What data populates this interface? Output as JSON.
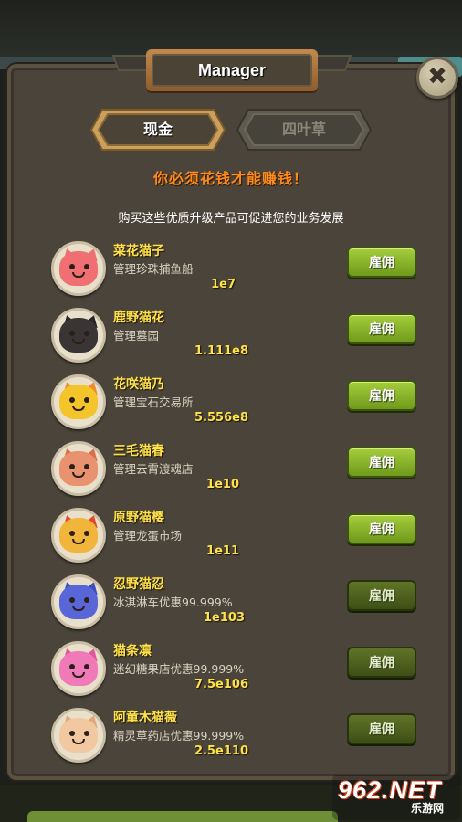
{
  "window": {
    "title": "Manager"
  },
  "tabs": [
    {
      "label": "现金",
      "active": true
    },
    {
      "label": "四叶草",
      "active": false
    }
  ],
  "headline": "你必须花钱才能赚钱！",
  "subline": "购买这些优质升级产品可促进您的业务发展",
  "managers": [
    {
      "name": "菜花猫子",
      "desc": "管理珍珠捕鱼船",
      "cost": "1e7",
      "hire_label": "雇佣",
      "hire_enabled": true,
      "face_color": "#ef6f72",
      "ear_color": "#ef6f72"
    },
    {
      "name": "鹿野猫花",
      "desc": "管理墓园",
      "cost": "1.111e8",
      "hire_label": "雇佣",
      "hire_enabled": true,
      "face_color": "#3a3535",
      "ear_color": "#2a2626"
    },
    {
      "name": "花咲猫乃",
      "desc": "管理宝石交易所",
      "cost": "5.556e8",
      "hire_label": "雇佣",
      "hire_enabled": true,
      "face_color": "#f4c52a",
      "ear_color": "#f08a2a"
    },
    {
      "name": "三毛猫春",
      "desc": "管理云霄渡魂店",
      "cost": "1e10",
      "hire_label": "雇佣",
      "hire_enabled": true,
      "face_color": "#e99270",
      "ear_color": "#d96f4c"
    },
    {
      "name": "原野猫樱",
      "desc": "管理龙蛋市场",
      "cost": "1e11",
      "hire_label": "雇佣",
      "hire_enabled": true,
      "face_color": "#f2b53c",
      "ear_color": "#e04a2c"
    },
    {
      "name": "忍野猫忍",
      "desc": "冰淇淋车优惠99.999%",
      "cost": "1e103",
      "hire_label": "雇佣",
      "hire_enabled": false,
      "face_color": "#5866d8",
      "ear_color": "#3f4cbb"
    },
    {
      "name": "猫条凛",
      "desc": "迷幻糖果店优惠99.999%",
      "cost": "7.5e106",
      "hire_label": "雇佣",
      "hire_enabled": false,
      "face_color": "#f07ab7",
      "ear_color": "#e0559c"
    },
    {
      "name": "阿童木猫薇",
      "desc": "精灵草药店优惠99.999%",
      "cost": "2.5e110",
      "hire_label": "雇佣",
      "hire_enabled": false,
      "face_color": "#f2c8a0",
      "ear_color": "#e0a77a"
    }
  ],
  "watermark": {
    "main": "962.NET",
    "sub": "乐游网"
  },
  "colors": {
    "accent_orange": "#ff8a1c",
    "gold": "#ffe14a",
    "button_green": "#8cb82c",
    "panel": "#4a443b"
  }
}
